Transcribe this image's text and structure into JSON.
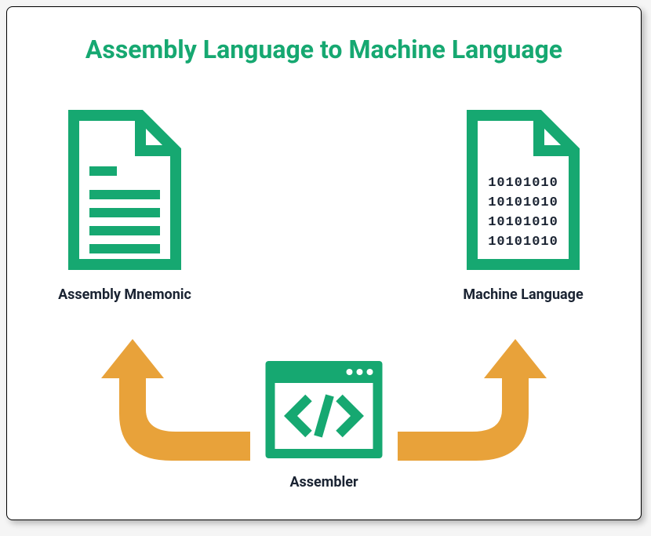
{
  "title": "Assembly Language to Machine Language",
  "nodes": {
    "left": {
      "label": "Assembly Mnemonic"
    },
    "right": {
      "label": "Machine Language",
      "binary_lines": [
        "10101010",
        "10101010",
        "10101010",
        "10101010"
      ]
    },
    "bottom": {
      "label": "Assembler"
    }
  },
  "colors": {
    "accent": "#16a871",
    "arrow": "#e8a23a",
    "text": "#1a2332"
  }
}
